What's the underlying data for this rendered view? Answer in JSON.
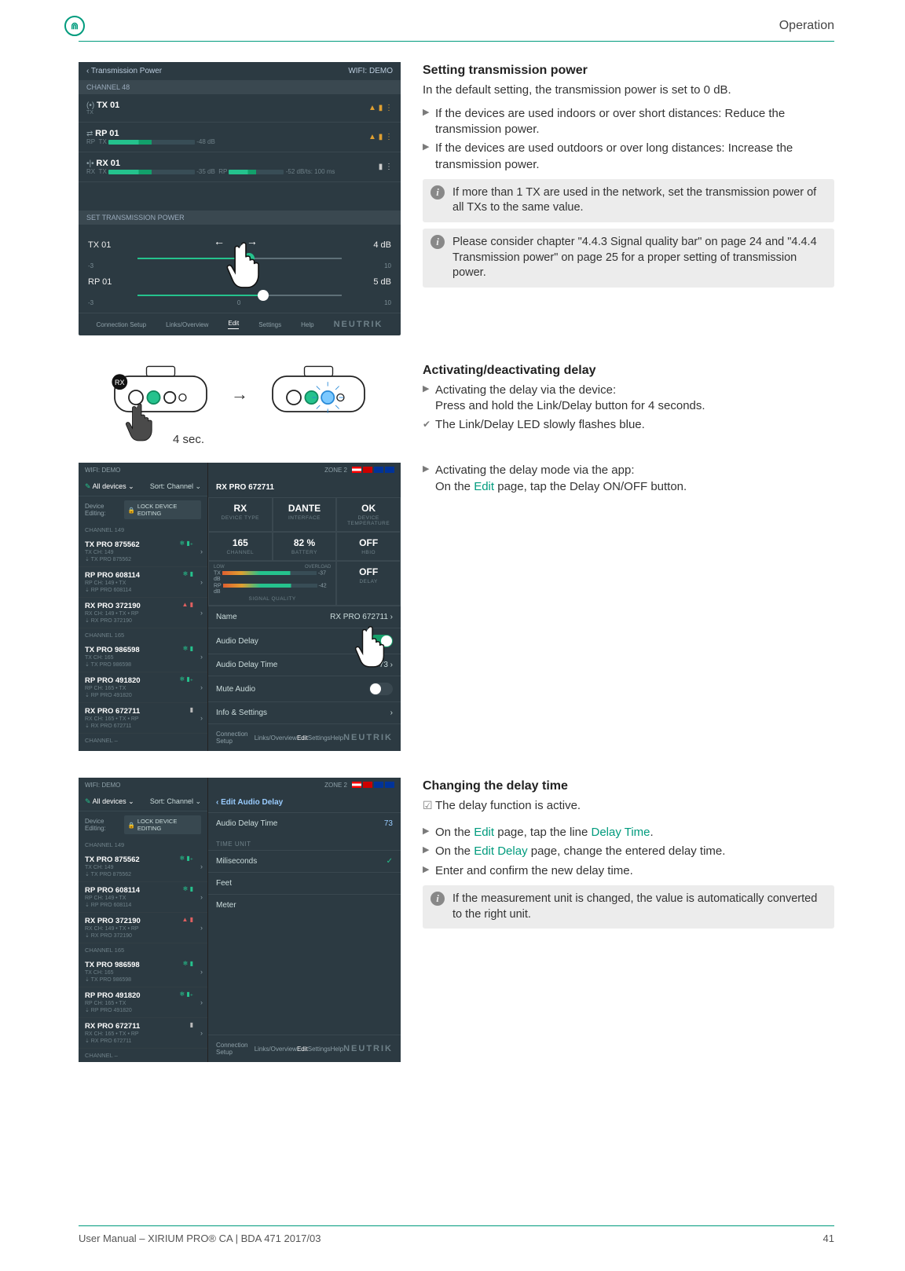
{
  "header": {
    "section": "Operation"
  },
  "figure1": {
    "top_back": "‹  Transmission Power",
    "top_right": "WIFI: DEMO",
    "channel_header": "CHANNEL 48",
    "tx_label": "TX 01",
    "rp_label": "RP 01",
    "rp_db": "-48 dB",
    "rx_label": "RX 01",
    "rx_info_tx": "-35 dB",
    "rx_info_rp": "-52 dB/ts: 100 ms",
    "set_header": "SET TRANSMISSION POWER",
    "tx_slider_label": "TX 01",
    "tx_slider_val": "4 dB",
    "rp_slider_label": "RP 01",
    "rp_slider_val": "5 dB",
    "scale_min": "-3",
    "scale_mid": "0",
    "scale_max": "10",
    "nav": [
      "Connection Setup",
      "Links/Overview",
      "Edit",
      "Settings",
      "Help"
    ],
    "brand": "NEUTRIK"
  },
  "section1": {
    "title": "Setting transmission power",
    "intro": "In the default setting, the transmission power is set to 0 dB.",
    "b1": "If the devices are used indoors or over short distances: Reduce the transmission power.",
    "b2": "If the devices are used outdoors or over long distances: Increase the transmission power.",
    "info1": "If more than 1 TX are used in the network, set the transmission power of all TXs to the same value.",
    "info2": "Please consider chapter \"4.4.3 Signal quality bar\" on page 24 and \"4.4.4 Transmission power\" on page 25 for a proper setting of transmission power."
  },
  "diagram": {
    "label_rx": "RX",
    "caption": "4 sec."
  },
  "section2": {
    "title": "Activating/deactivating delay",
    "b1": "Activating the delay via the device:",
    "b1_sub": "Press and hold the Link/Delay button for 4 seconds.",
    "c1": "The Link/Delay LED slowly flashes blue."
  },
  "figure2": {
    "wifi": "WIFI: DEMO",
    "zone": "ZONE 2",
    "all_devices": "All devices ⌄",
    "sort": "Sort: Channel  ⌄",
    "device_editing": "Device Editing:",
    "lock": "LOCK DEVICE EDITING",
    "ch149": "CHANNEL 149",
    "ch165": "CHANNEL 165",
    "channel_dots": "CHANNEL –",
    "devices": [
      {
        "name": "TX PRO 875562",
        "info": "TX   CH: 149",
        "link": "⇣ TX PRO 875562"
      },
      {
        "name": "RP PRO 608114",
        "info": "RP   CH: 149   • TX",
        "link": "⇣ RP PRO 608114"
      },
      {
        "name": "RX PRO 372190",
        "info": "RX   CH: 149   • TX  • RP",
        "link": "⇣ RX PRO 372190"
      },
      {
        "name": "TX PRO 986598",
        "info": "TX   CH: 165",
        "link": "⇣ TX PRO 986598"
      },
      {
        "name": "RP PRO 491820",
        "info": "RP   CH: 165   • TX",
        "link": "⇣ RP PRO 491820"
      },
      {
        "name": "RX PRO 672711",
        "info": "RX   CH: 165   • TX  • RP",
        "link": "⇣ RX PRO 672711"
      }
    ],
    "main_title": "RX PRO 672711",
    "stats": {
      "rx": "RX",
      "rx_lab": "DEVICE TYPE",
      "dante": "DANTE",
      "dante_lab": "INTERFACE",
      "ok": "OK",
      "ok_lab": "DEVICE TEMPERATURE",
      "chan": "165",
      "chan_lab": "CHANNEL",
      "batt": "82 %",
      "batt_lab": "BATTERY",
      "hbio": "OFF",
      "hbio_lab": "HBIO",
      "sig_tx": "-37 dB",
      "sig_rp": "-42 dB",
      "sig_low": "LOW",
      "sig_ovl": "OVERLOAD",
      "sig_lab": "SIGNAL QUALITY",
      "delay": "OFF",
      "delay_lab": "DELAY"
    },
    "rows": {
      "name": "Name",
      "name_val": "RX PRO 672711  ›",
      "audio_delay": "Audio Delay",
      "audio_delay_time": "Audio Delay Time",
      "audio_delay_time_val": "73  ›",
      "mute": "Mute Audio",
      "info": "Info & Settings"
    }
  },
  "section3": {
    "b1": "Activating the delay mode via the app:",
    "b1_sub_pre": "On the ",
    "b1_sub_link": "Edit",
    "b1_sub_post": " page, tap the Delay ON/OFF button."
  },
  "figure3": {
    "back": "‹  Edit Audio Delay",
    "audio_delay_time": "Audio Delay Time",
    "audio_delay_time_val": "73",
    "time_unit": "TIME UNIT",
    "ms": "Miliseconds",
    "feet": "Feet",
    "meter": "Meter"
  },
  "section4": {
    "title": "Changing the delay time",
    "c1": "The delay function is active.",
    "b1_pre": "On the ",
    "b1_l1": "Edit",
    "b1_mid": " page, tap the line ",
    "b1_l2": "Delay Time",
    "b1_post": ".",
    "b2_pre": "On the ",
    "b2_l1": "Edit Delay",
    "b2_post": " page, change the entered delay time.",
    "b3": "Enter and confirm the new delay time.",
    "info": "If the measurement unit is changed, the value is automatically converted to the right unit."
  },
  "footer": {
    "left": "User Manual – XIRIUM PRO® CA | BDA 471 2017/03",
    "page": "41"
  }
}
